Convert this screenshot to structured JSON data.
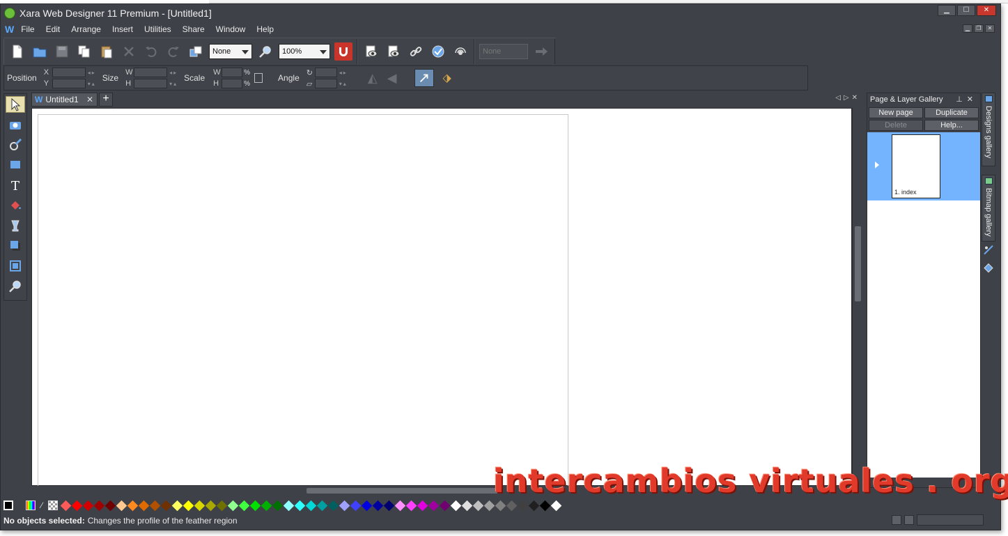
{
  "window": {
    "title": "Xara Web Designer 11 Premium - [Untitled1]"
  },
  "menu": {
    "logo": "W",
    "items": [
      "File",
      "Edit",
      "Arrange",
      "Insert",
      "Utilities",
      "Share",
      "Window",
      "Help"
    ]
  },
  "toolbar": {
    "blend_value": "None",
    "zoom_value": "100%",
    "disabled_combo_value": "None"
  },
  "infobar": {
    "position_label": "Position",
    "x_label": "X",
    "y_label": "Y",
    "size_label": "Size",
    "w_label": "W",
    "h_label": "H",
    "scale_label": "Scale",
    "scale_w_label": "W",
    "scale_h_label": "H",
    "percent": "%",
    "angle_label": "Angle"
  },
  "tabs": {
    "doc_icon": "W",
    "doc_name": "Untitled1",
    "close": "✕",
    "add": "+"
  },
  "gallery": {
    "title": "Page & Layer Gallery",
    "new_page": "New page",
    "duplicate": "Duplicate",
    "delete": "Delete",
    "help": "Help...",
    "page_label": "1. index"
  },
  "sidetabs": {
    "designs": "Designs gallery",
    "bitmap": "Bitmap gallery"
  },
  "status": {
    "bold": "No objects selected:",
    "message": "Changes the profile of the feather region"
  },
  "watermark": {
    "text": "intercambios virtuales . org"
  },
  "colors": {
    "accent": "#74b4ff",
    "chrome": "#3e4147",
    "magnet": "#c9352a",
    "watermark": "#e23a2a"
  },
  "palette": [
    "#ff5a5a",
    "#ff0000",
    "#d00000",
    "#a00000",
    "#700000",
    "#ffc890",
    "#ff8a20",
    "#e06a00",
    "#b05000",
    "#703000",
    "#ffff60",
    "#ffff00",
    "#d8d800",
    "#a8a800",
    "#707000",
    "#90ff90",
    "#40ff40",
    "#00e000",
    "#00b000",
    "#007000",
    "#90ffff",
    "#30ffff",
    "#00d8d8",
    "#00a0a0",
    "#006060",
    "#a0a0ff",
    "#4040ff",
    "#0000e0",
    "#0000a0",
    "#000070",
    "#ff90ff",
    "#ff40ff",
    "#e000e0",
    "#a000a0",
    "#700070",
    "#ffffff",
    "#e0e0e0",
    "#c0c0c0",
    "#a0a0a0",
    "#808080",
    "#606060",
    "#404040",
    "#202020",
    "#000000",
    "#ffffff"
  ]
}
